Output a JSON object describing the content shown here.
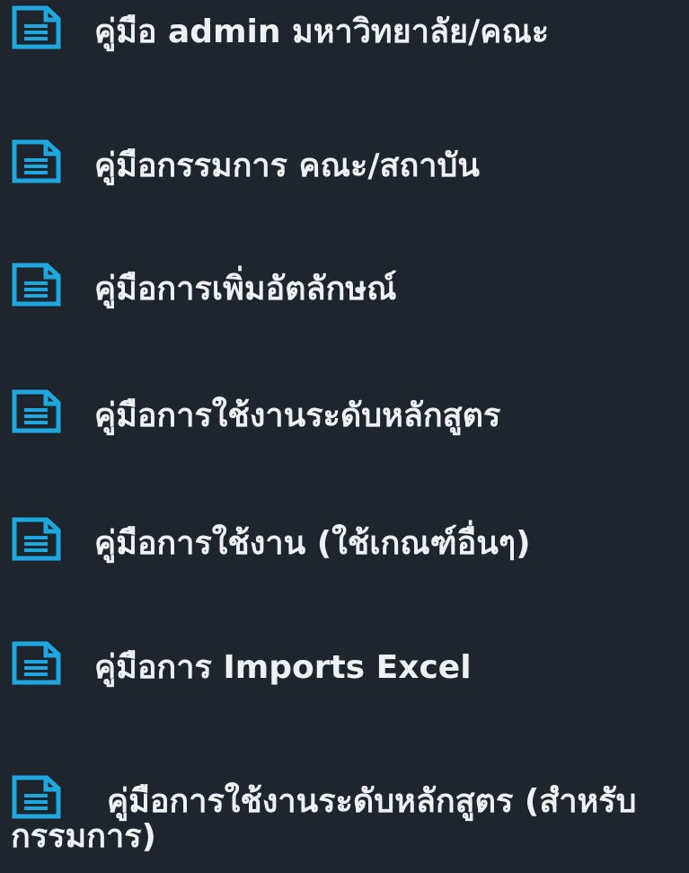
{
  "icon": "document-icon",
  "accent_color": "#1fa8e0",
  "background_color": "#1f252d",
  "text_color": "#eef1f4",
  "manuals": [
    {
      "label": "คู่มือ admin มหาวิทยาลัย/คณะ"
    },
    {
      "label": "คู่มือกรรมการ คณะ/สถาบัน"
    },
    {
      "label": "คู่มือการเพิ่มอัตลักษณ์"
    },
    {
      "label": "คู่มือการใช้งานระดับหลักสูตร"
    },
    {
      "label": "คู่มือการใช้งาน (ใช้เกณฑ์อื่นๆ)"
    },
    {
      "label": "คู่มือการ Imports Excel"
    },
    {
      "label": "คู่มือการใช้งานระดับหลักสูตร (สำหรับกรรมการ)"
    }
  ]
}
